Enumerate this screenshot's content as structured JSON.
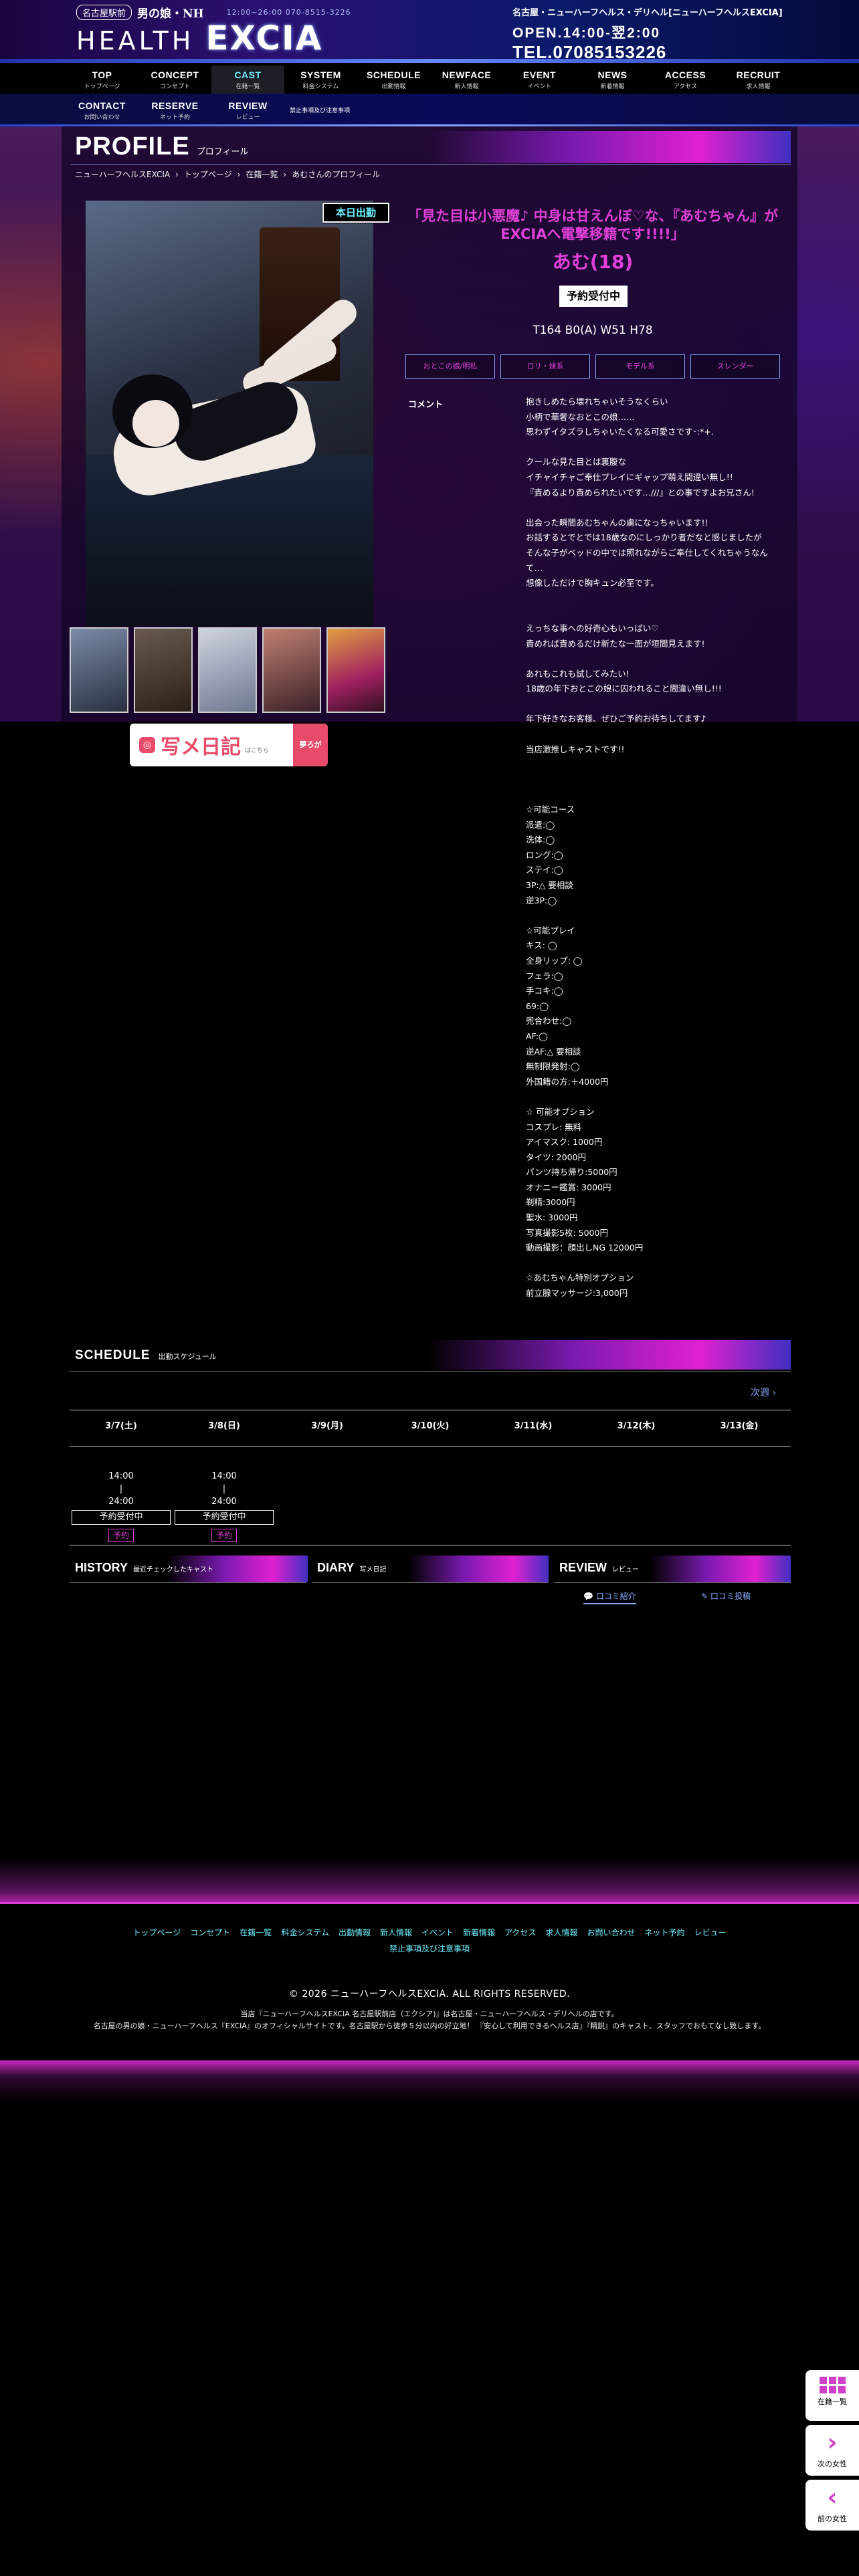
{
  "header": {
    "badge": "名古屋駅前",
    "sub": "男の娘・NH",
    "info": "12:00~26:00  070-8515-3226",
    "logo_health": "HEALTH",
    "logo_excia": "EXCIA",
    "category": "名古屋・ニューハーフヘルス・デリヘル[ニューハーフヘルスEXCIA]",
    "open": "OPEN.14:00-翌2:00",
    "tel": "TEL.07085153226"
  },
  "nav": [
    {
      "en": "TOP",
      "jp": "トップページ"
    },
    {
      "en": "CONCEPT",
      "jp": "コンセプト"
    },
    {
      "en": "CAST",
      "jp": "在籍一覧"
    },
    {
      "en": "SYSTEM",
      "jp": "料金システム"
    },
    {
      "en": "SCHEDULE",
      "jp": "出勤情報"
    },
    {
      "en": "NEWFACE",
      "jp": "新人情報"
    },
    {
      "en": "EVENT",
      "jp": "イベント"
    },
    {
      "en": "NEWS",
      "jp": "新着情報"
    },
    {
      "en": "ACCESS",
      "jp": "アクセス"
    },
    {
      "en": "RECRUIT",
      "jp": "求人情報"
    }
  ],
  "nav2": [
    {
      "en": "CONTACT",
      "jp": "お問い合わせ"
    },
    {
      "en": "RESERVE",
      "jp": "ネット予約"
    },
    {
      "en": "REVIEW",
      "jp": "レビュー"
    }
  ],
  "nav2_small": "禁止事項及び注意事項",
  "profile": {
    "title_en": "PROFILE",
    "title_jp": "プロフィール",
    "breadcrumb": [
      "ニューハーフヘルスEXCIA",
      "›",
      "トップページ",
      "›",
      "在籍一覧",
      "›",
      "あむさんのプロフィール"
    ],
    "today_badge": "本日出勤",
    "catch": "「見た目は小悪魔♪ 中身は甘えんぼ♡な、『あむちゃん』がEXCIAへ電撃移籍です!!!!」",
    "name": "あむ(18)",
    "status": "予約受付中",
    "size": "T164 B0(A) W51 H78",
    "tags": [
      "おとこの娘/明私",
      "ロリ・妹系",
      "モデル系",
      "スレンダー"
    ],
    "comment_label": "コメント",
    "comment": "抱きしめたら壊れちゃいそうなくらい\n小柄で華奢なおとこの娘……\n思わずイタズラしちゃいたくなる可愛さです･:*+.\n\nクールな見た目とは裏腹な\nイチャイチャご奉仕プレイにギャップ萌え間違い無し!!\n『責めるより責められたいです…///』との事ですよお兄さん!\n\n出会った瞬間あむちゃんの虜になっちゃいます!!\nお話するとでとでは18歳なのにしっかり者だなと感じましたが\nそんな子がベッドの中では照れながらご奉仕してくれちゃうなんて…\n想像しただけで胸キュン必至です。\n\n\nえっちな事への好奇心もいっぱい♡\n責めれば責めるだけ新たな一面が垣間見えます!\n\nあれもこれも試してみたい!\n18歳の年下おとこの娘に囚われること間違い無し!!!\n\n年下好きなお客様、ぜひご予約お待ちしてます♪\n\n当店激推しキャストです!!\n\n\n\n☆可能コース\n派遣:◯\n洗体:◯\nロング:◯\nステイ:◯\n3P:△ 要相談\n逆3P:◯\n\n☆可能プレイ\nキス: ◯\n全身リップ: ◯\nフェラ:◯\n手コキ:◯\n69:◯\n兜合わせ:◯\nAF:◯\n逆AF:△ 要相談\n無制限発射:◯\n外国籍の方:＋4000円\n\n☆ 可能オプション\nコスプレ: 無料\nアイマスク: 1000円\nタイツ: 2000円\nパンツ持ち帰り:5000円\nオナニー鑑賞: 3000円\n剃精:3000円\n聖水: 3000円\n写真撮影5枚: 5000円\n動画撮影：顔出しNG 12000円\n\n☆あむちゃん特別オプション\n前立腺マッサージ:3,000円"
  },
  "diary_banner": {
    "text": "写メ日記",
    "small": "はこちら",
    "pink": "夢ろが"
  },
  "schedule": {
    "title_en": "SCHEDULE",
    "title_jp": "出勤スケジュール",
    "next": "次週 ›",
    "days": [
      "3/7(土)",
      "3/8(日)",
      "3/9(月)",
      "3/10(火)",
      "3/11(水)",
      "3/12(木)",
      "3/13(金)"
    ],
    "slots": [
      {
        "start": "14:00",
        "sep": "|",
        "end": "24:00",
        "status": "予約受付中",
        "btn": "予約"
      },
      {
        "start": "14:00",
        "sep": "|",
        "end": "24:00",
        "status": "予約受付中",
        "btn": "予約"
      }
    ]
  },
  "boxes": {
    "history": {
      "en": "HISTORY",
      "jp": "最近チェックしたキャスト"
    },
    "diary": {
      "en": "DIARY",
      "jp": "写メ日記"
    },
    "review": {
      "en": "REVIEW",
      "jp": "レビュー",
      "tab1": "💬 口コミ紹介",
      "tab2": "✎ 口コミ投稿"
    }
  },
  "footer": {
    "links": [
      "トップページ",
      "コンセプト",
      "在籍一覧",
      "料金システム",
      "出勤情報",
      "新人情報",
      "イベント",
      "新着情報",
      "アクセス",
      "求人情報",
      "お問い合わせ",
      "ネット予約",
      "レビュー"
    ],
    "link_last": "禁止事項及び注意事項",
    "copyright": "© 2026 ニューハーフヘルスEXCIA. ALL RIGHTS RESERVED.",
    "desc1": "当店『ニューハーフヘルスEXCIA 名古屋駅前店（エクシア)』は名古屋・ニューハーフヘルス・デリヘルの店です。",
    "desc2": "名古屋の男の娘・ニューハーフヘルス『EXCIA』のオフィシャルサイトです。名古屋駅から徒歩５分以内の好立地！ 『安心して利用できるヘルス店』『精鋭』のキャスト、スタッフでおもてなし致します。"
  },
  "side": {
    "cast": "在籍一覧",
    "next": "次の女性",
    "prev": "前の女性"
  },
  "colors": {
    "accent_pink": "#e040d8",
    "accent_cyan": "#6ef0ff",
    "link_blue": "#88aaff"
  }
}
